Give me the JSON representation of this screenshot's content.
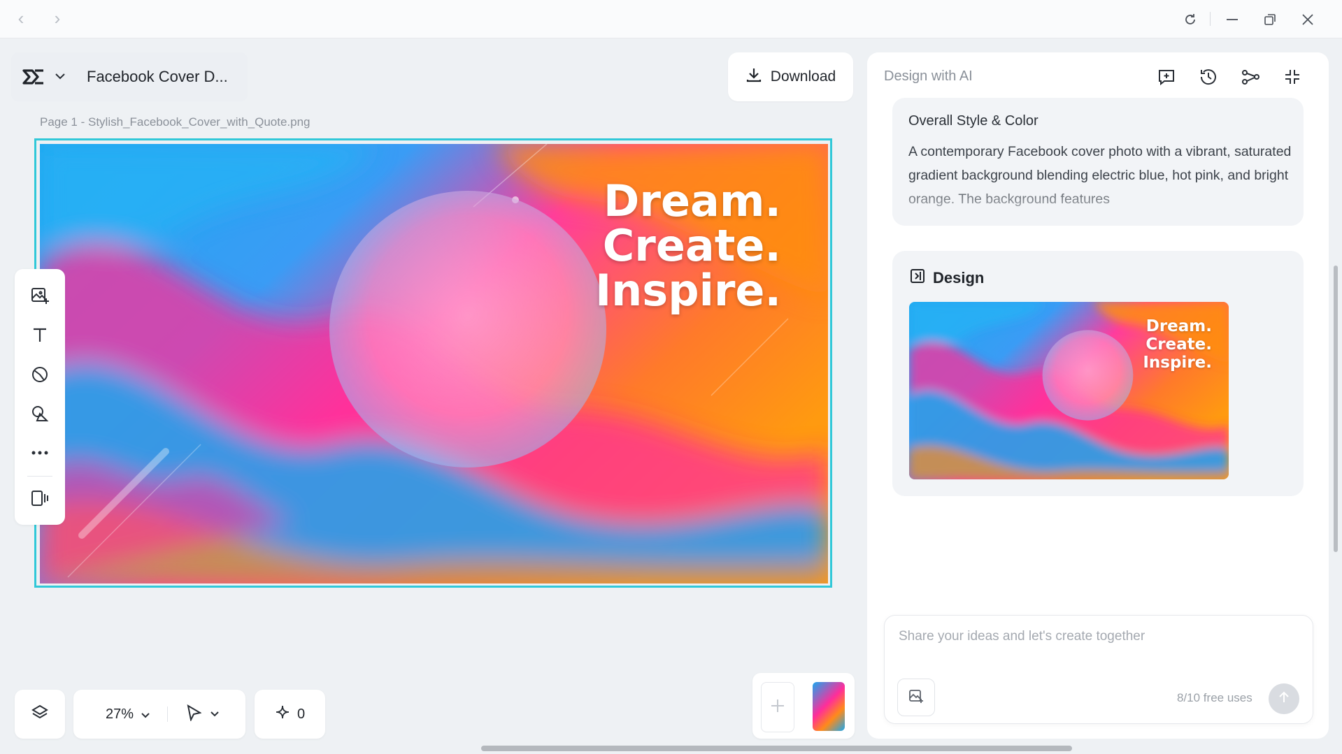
{
  "titlebar": {
    "back_icon": "chevron-left-icon",
    "forward_icon": "chevron-right-icon",
    "refresh_icon": "refresh-icon",
    "minimize_icon": "minimize-icon",
    "restore_icon": "restore-icon",
    "close_icon": "close-icon"
  },
  "document": {
    "title": "Facebook Cover D...",
    "page_label": "Page 1 -  Stylish_Facebook_Cover_with_Quote.png",
    "download_label": "Download"
  },
  "canvas": {
    "headline_lines": [
      "Dream.",
      "Create.",
      "Inspire."
    ]
  },
  "toolbar": {
    "tools": [
      "add-image-icon",
      "text-icon",
      "shapes-icon",
      "elements-icon",
      "more-icon",
      "pages-icon"
    ]
  },
  "bottom": {
    "zoom": "27%",
    "credits": "0"
  },
  "panel": {
    "title": "Design with AI",
    "style_card": {
      "title": "Overall Style & Color",
      "text": "A contemporary Facebook cover photo with a vibrant, saturated gradient background blending electric blue, hot pink, and bright orange. The background features"
    },
    "design_card": {
      "title": "Design",
      "thumb_lines": [
        "Dream.",
        "Create.",
        "Inspire."
      ]
    },
    "chat": {
      "placeholder": "Share your ideas and let's create together",
      "uses": "8/10 free uses"
    }
  },
  "colors": {
    "accent_frame": "#31c8d8",
    "gradient": [
      "#1aa7ef",
      "#ff2d9a",
      "#ff8a1a"
    ]
  }
}
